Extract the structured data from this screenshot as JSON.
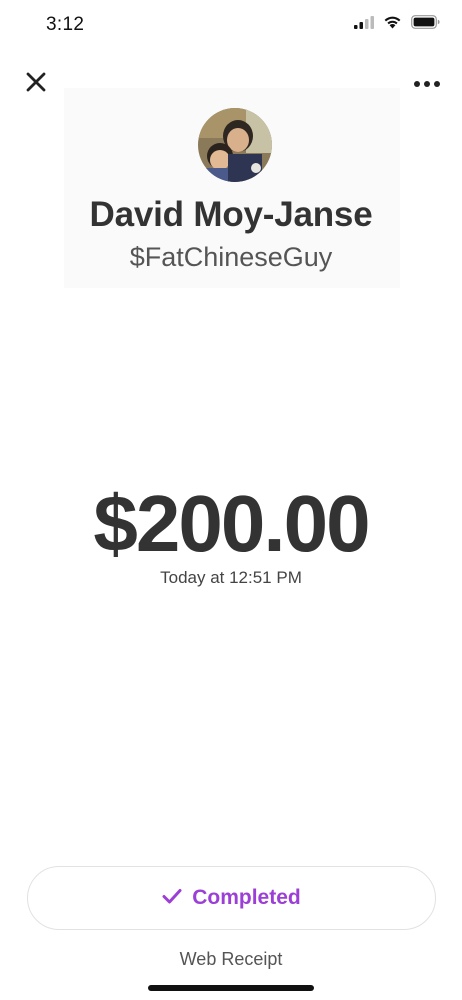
{
  "status_bar": {
    "time": "3:12",
    "icons": [
      "cellular-signal-icon",
      "wifi-icon",
      "battery-icon"
    ]
  },
  "nav": {
    "close_icon": "close-icon",
    "more_icon": "more-options-icon"
  },
  "profile": {
    "name": "David Moy-Janse",
    "cashtag": "$FatChineseGuy",
    "avatar": "avatar-photo"
  },
  "payment": {
    "amount": "$200.00",
    "timestamp": "Today at 12:51 PM"
  },
  "actions": {
    "status_label": "Completed",
    "status_icon": "checkmark-icon",
    "web_receipt_label": "Web Receipt"
  },
  "colors": {
    "accent": "#9b3fd6",
    "text_primary": "#333333"
  }
}
